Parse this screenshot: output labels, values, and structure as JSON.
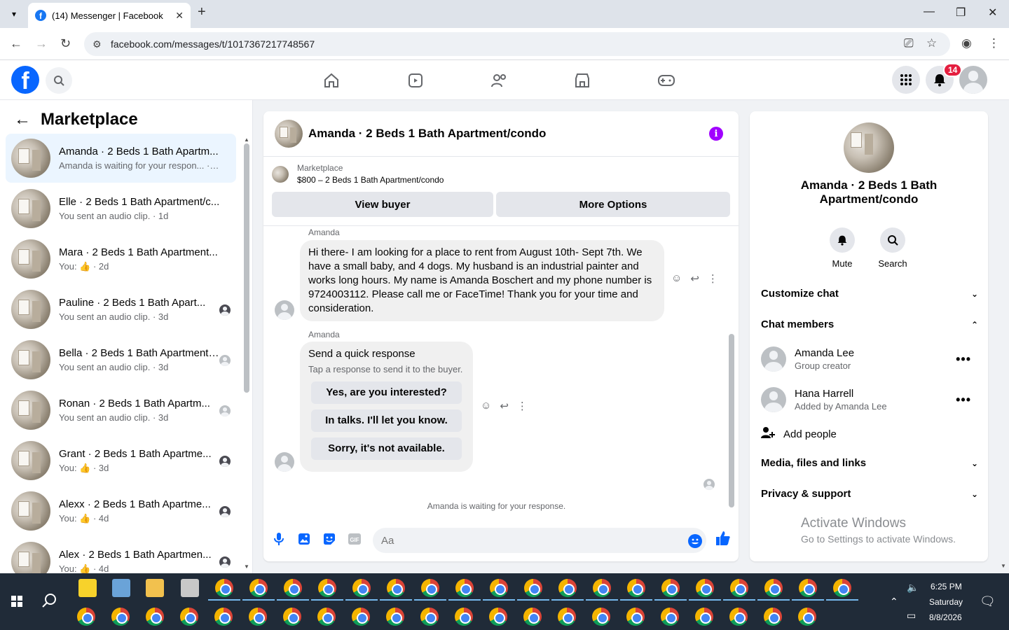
{
  "browser": {
    "tab_title": "(14) Messenger | Facebook",
    "url": "facebook.com/messages/t/1017367217748567"
  },
  "header": {
    "notification_count": "14"
  },
  "sidebar": {
    "title": "Marketplace",
    "conversations": [
      {
        "name": "Amanda · 2 Beds 1 Bath Apartm...",
        "sub": "Amanda is waiting for your respon... · 5h",
        "active": true
      },
      {
        "name": "Elle · 2 Beds 1 Bath Apartment/c...",
        "sub": "You sent an audio clip. · 1d"
      },
      {
        "name": "Mara · 2 Beds 1 Bath Apartment...",
        "sub": "You: 👍 · 2d"
      },
      {
        "name": "Pauline · 2 Beds 1 Bath Apart...",
        "sub": "You sent an audio clip. · 3d"
      },
      {
        "name": "Bella · 2 Beds 1 Bath Apartment/...",
        "sub": "You sent an audio clip. · 3d"
      },
      {
        "name": "Ronan · 2 Beds 1 Bath Apartm...",
        "sub": "You sent an audio clip. · 3d"
      },
      {
        "name": "Grant · 2 Beds 1 Bath Apartme...",
        "sub": "You: 👍 · 3d"
      },
      {
        "name": "Alexx · 2 Beds 1 Bath Apartme...",
        "sub": "You: 👍 · 4d"
      },
      {
        "name": "Alex · 2 Beds 1 Bath Apartmen...",
        "sub": "You: 👍 · 4d"
      }
    ]
  },
  "chat": {
    "title": "Amanda · 2 Beds 1 Bath Apartment/condo",
    "marketplace_label": "Marketplace",
    "listing": "$800 – 2 Beds 1 Bath Apartment/condo",
    "view_buyer": "View buyer",
    "more_options": "More Options",
    "messages": [
      {
        "sender": "Amanda",
        "text": "Hi there- I am looking for a place to rent from August 10th- Sept 7th. We have a small baby, and 4 dogs. My husband is an industrial painter and works long hours. My name is Amanda Boschert and my phone number is 9724003112. Please call me or FaceTime! Thank you for your time and consideration."
      }
    ],
    "quick_response": {
      "sender": "Amanda",
      "title": "Send a quick response",
      "subtitle": "Tap a response to send it to the buyer.",
      "options": [
        "Yes, are you interested?",
        "In talks. I'll let you know.",
        "Sorry, it's not available."
      ]
    },
    "waiting_text": "Amanda is waiting for your response.",
    "input_placeholder": "Aa"
  },
  "details": {
    "name": "Amanda · 2 Beds 1 Bath Apartment/condo",
    "mute": "Mute",
    "search": "Search",
    "customize_chat": "Customize chat",
    "chat_members": "Chat members",
    "members": [
      {
        "name": "Amanda Lee",
        "role": "Group creator"
      },
      {
        "name": "Hana Harrell",
        "role": "Added by Amanda Lee"
      }
    ],
    "add_people": "Add people",
    "media": "Media, files and links",
    "privacy": "Privacy & support",
    "activate_title": "Activate Windows",
    "activate_sub": "Go to Settings to activate Windows."
  },
  "taskbar": {
    "time": "6:25 PM",
    "day": "Saturday",
    "date": "8/8/2026"
  },
  "colors": {
    "brand": "#0866ff",
    "active_row": "#ebf5ff",
    "info": "#a100ff",
    "badge": "#e41e3f"
  }
}
